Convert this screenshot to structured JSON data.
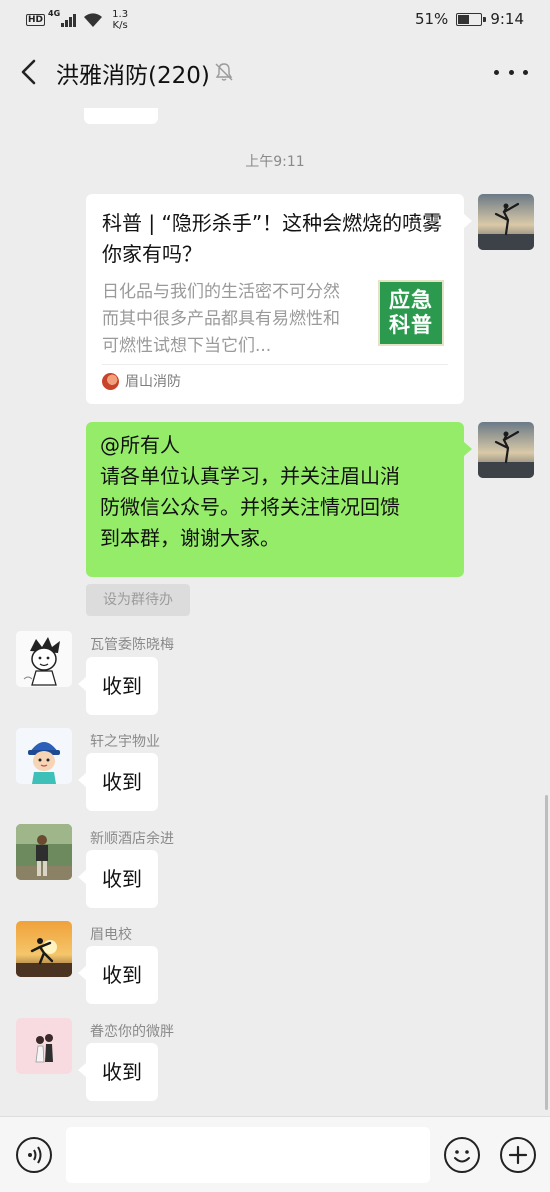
{
  "status_bar": {
    "network_type": "4G",
    "hd_badge": "HD",
    "speed_value": "1.3",
    "speed_unit": "K/s",
    "battery_percent": "51%",
    "battery_level": 0.51,
    "time": "9:14"
  },
  "header": {
    "title": "洪雅消防(220)",
    "icons": [
      "back-arrow-icon",
      "mute-bell-icon",
      "more-dots-icon"
    ]
  },
  "chat": {
    "timestamp": "上午9:11",
    "article": {
      "title": "科普 | “隐形杀手”！这种会燃烧的喷雾你家有吗？",
      "description": "日化品与我们的生活密不可分然而其中很多产品都具有易燃性和可燃性试想下当它们...",
      "thumbnail_line1": "应急",
      "thumbnail_line2": "科普",
      "source": "眉山消防",
      "thumbnail_color": "#2b9a4e"
    },
    "my_message": {
      "lines": [
        "@所有人",
        "请各单位认真学习，并关注眉山消",
        "防微信公众号。并将关注情况回馈",
        "到本群，谢谢大家。"
      ],
      "bubble_color": "#95ec69"
    },
    "todo_chip": "设为群待办",
    "incoming": [
      {
        "sender": "瓦管委陈晓梅",
        "text": "收到"
      },
      {
        "sender": "轩之宇物业",
        "text": "收到"
      },
      {
        "sender": "新顺酒店余进",
        "text": "收到"
      },
      {
        "sender": "眉电校",
        "text": "收到"
      },
      {
        "sender": "眷恋你的微胖",
        "text": "收到"
      }
    ]
  },
  "input_bar": {
    "placeholder": "",
    "icons": [
      "voice-icon",
      "emoji-icon",
      "plus-icon"
    ]
  }
}
